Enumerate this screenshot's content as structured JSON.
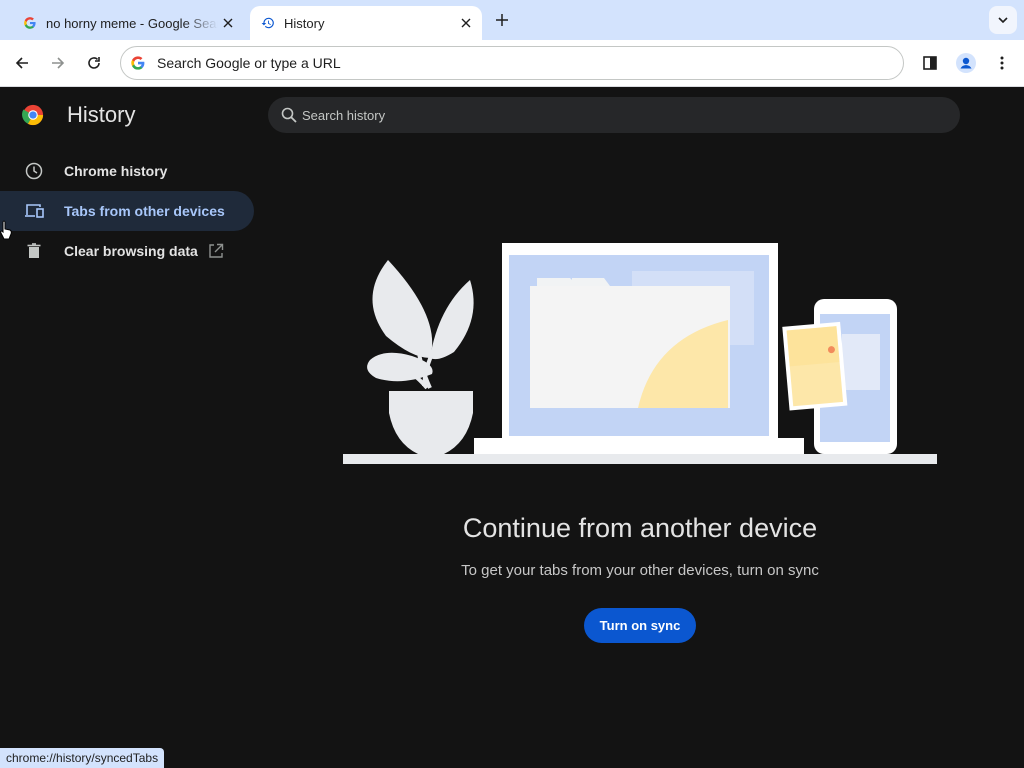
{
  "tabs": [
    {
      "title": "no horny meme - Google Search",
      "icon": "google-g-icon",
      "active": false
    },
    {
      "title": "History",
      "icon": "history-icon",
      "active": true
    }
  ],
  "toolbar": {
    "omnibox_placeholder": "Search Google or type a URL"
  },
  "sidebar": {
    "title": "History",
    "items": [
      {
        "label": "Chrome history",
        "icon": "clock-icon",
        "selected": false
      },
      {
        "label": "Tabs from other devices",
        "icon": "devices-icon",
        "selected": true
      },
      {
        "label": "Clear browsing data",
        "icon": "trash-icon",
        "selected": false,
        "external": true
      }
    ]
  },
  "search": {
    "placeholder": "Search history"
  },
  "main": {
    "heading": "Continue from another device",
    "subtext": "To get your tabs from your other devices, turn on sync",
    "button_label": "Turn on sync"
  },
  "status_bar": {
    "url": "chrome://history/syncedTabs"
  },
  "colors": {
    "tabstrip": "#d3e3fd",
    "page_bg": "#131313",
    "accent": "#0b57d0",
    "selected_text": "#a8c7fa"
  }
}
